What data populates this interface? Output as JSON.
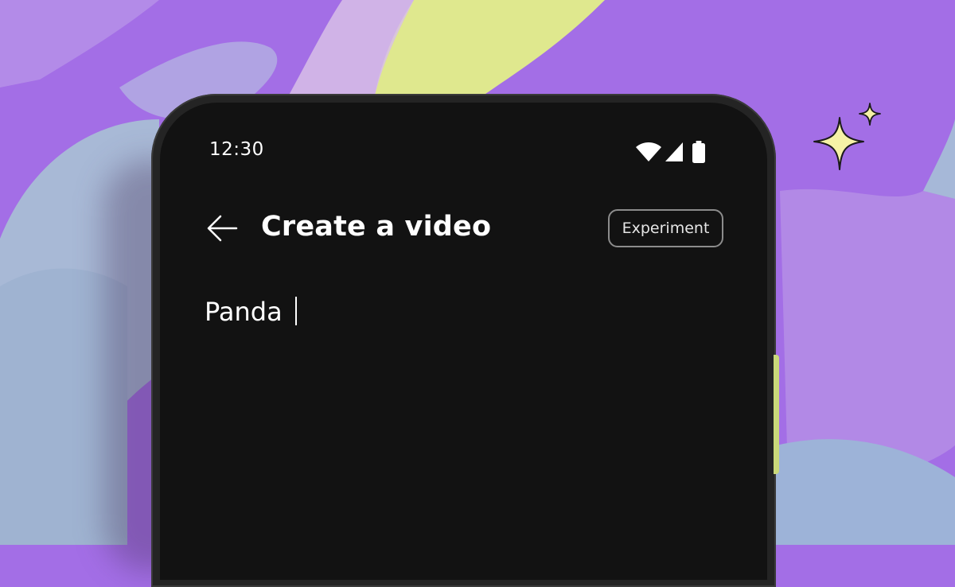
{
  "status_bar": {
    "time": "12:30",
    "icons": [
      "wifi-icon",
      "signal-icon",
      "battery-icon"
    ]
  },
  "header": {
    "back_icon": "arrow-left-icon",
    "title": "Create a video",
    "badge": "Experiment"
  },
  "prompt": {
    "value": "Panda "
  },
  "decoration": {
    "sparkle_icon": "sparkle-icon"
  },
  "colors": {
    "screen_background": "#121212",
    "phone_frame": "#242424",
    "backdrop_purple": "#a36ee6",
    "backdrop_lilac": "#b79be0",
    "backdrop_yellow": "#dfe88e",
    "sparkle_fill": "#f6f2a6",
    "text": "#ffffff"
  }
}
